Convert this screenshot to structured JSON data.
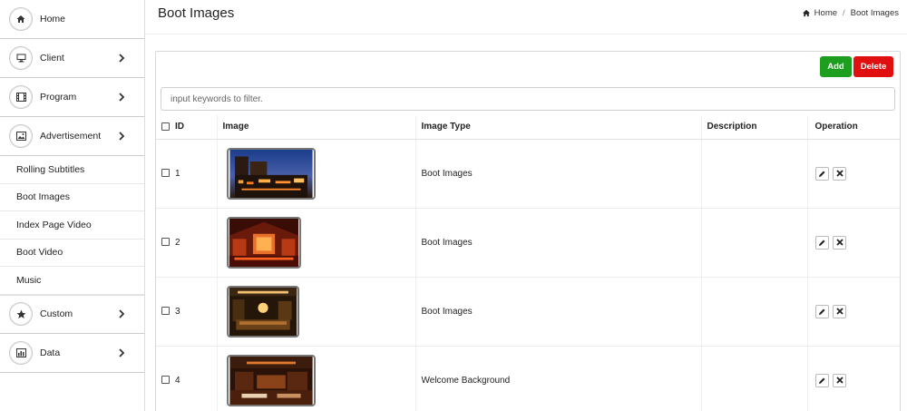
{
  "sidebar": {
    "items": [
      {
        "label": "Home",
        "icon": "home-icon"
      },
      {
        "label": "Client",
        "icon": "monitor-icon"
      },
      {
        "label": "Program",
        "icon": "film-icon"
      },
      {
        "label": "Advertisement",
        "icon": "picture-icon"
      }
    ],
    "subitems": [
      "Rolling Subtitles",
      "Boot Images",
      "Index Page Video",
      "Boot Video",
      "Music"
    ],
    "items2": [
      {
        "label": "Custom",
        "icon": "star-icon"
      },
      {
        "label": "Data",
        "icon": "chart-icon"
      }
    ]
  },
  "header": {
    "title": "Boot Images",
    "breadcrumb_home": "Home",
    "breadcrumb_current": "Boot Images"
  },
  "toolbar": {
    "add_label": "Add",
    "delete_label": "Delete"
  },
  "filter": {
    "placeholder": "input keywords to filter."
  },
  "table": {
    "columns": {
      "id": "ID",
      "image": "Image",
      "type": "Image Type",
      "description": "Description",
      "operation": "Operation"
    },
    "rows": [
      {
        "id": "1",
        "type": "Boot Images",
        "description": ""
      },
      {
        "id": "2",
        "type": "Boot Images",
        "description": ""
      },
      {
        "id": "3",
        "type": "Boot Images",
        "description": ""
      },
      {
        "id": "4",
        "type": "Welcome Background",
        "description": ""
      }
    ]
  },
  "colors": {
    "add": "#1e9e1e",
    "delete": "#e01010"
  }
}
